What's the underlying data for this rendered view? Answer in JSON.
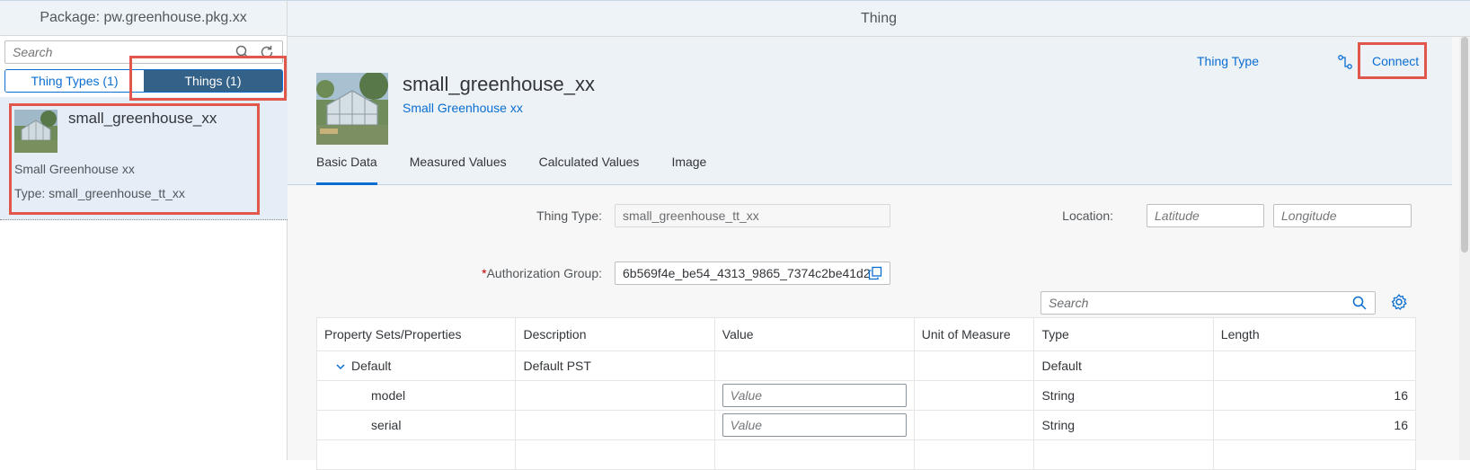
{
  "left": {
    "header": "Package: pw.greenhouse.pkg.xx",
    "search_placeholder": "Search",
    "segments": [
      "Thing Types (1)",
      "Things (1)"
    ],
    "item": {
      "title": "small_greenhouse_xx",
      "description": "Small Greenhouse xx",
      "type": "Type: small_greenhouse_tt_xx"
    }
  },
  "detail": {
    "header": "Thing",
    "title": "small_greenhouse_xx",
    "subtitle": "Small Greenhouse xx",
    "actions": {
      "thing_type": "Thing Type",
      "connect": "Connect"
    },
    "tabs": [
      "Basic Data",
      "Measured Values",
      "Calculated Values",
      "Image"
    ],
    "form": {
      "thing_type_label": "Thing Type:",
      "thing_type_value": "small_greenhouse_tt_xx",
      "location_label": "Location:",
      "latitude_placeholder": "Latitude",
      "longitude_placeholder": "Longitude",
      "auth_required": "*",
      "auth_label": "Authorization Group:",
      "auth_value": "6b569f4e_be54_4313_9865_7374c2be41d2"
    },
    "table": {
      "search_placeholder": "Search",
      "columns": [
        "Property Sets/Properties",
        "Description",
        "Value",
        "Unit of Measure",
        "Type",
        "Length"
      ],
      "rows": [
        {
          "name": "Default",
          "description": "Default PST",
          "value": "",
          "uom": "",
          "type": "Default",
          "length": ""
        },
        {
          "name": "model",
          "description": "",
          "value_placeholder": "Value",
          "uom": "",
          "type": "String",
          "length": "16"
        },
        {
          "name": "serial",
          "description": "",
          "value_placeholder": "Value",
          "uom": "",
          "type": "String",
          "length": "16"
        }
      ]
    }
  },
  "colors": {
    "accent": "#0a6ed1",
    "selected_segment": "#346187",
    "highlight": "#e2574c"
  }
}
